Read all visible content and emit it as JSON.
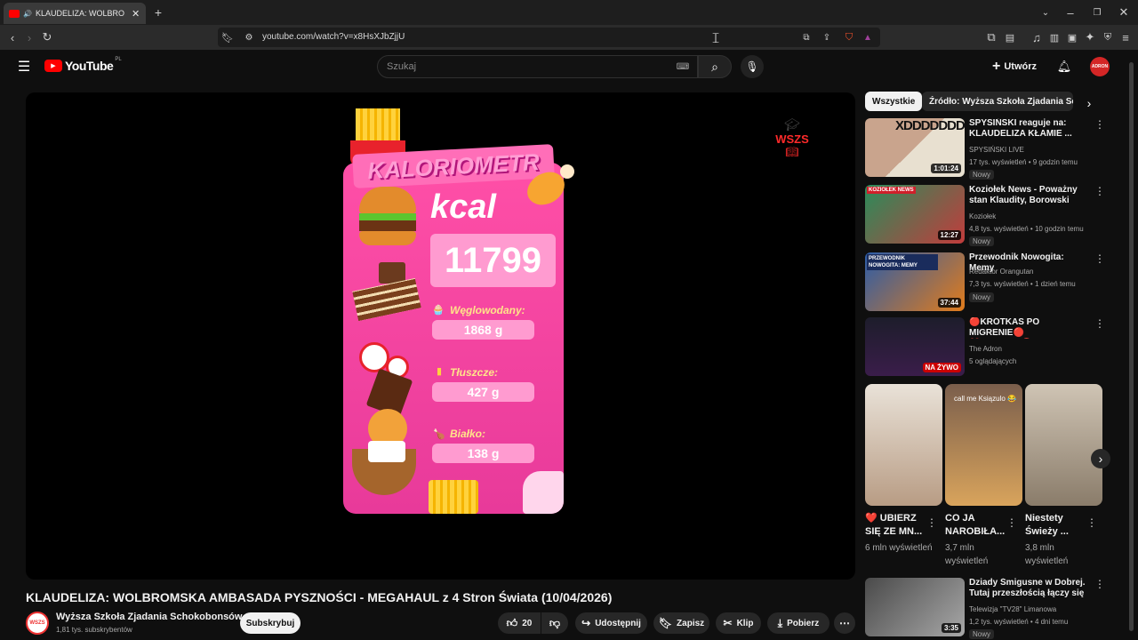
{
  "browser": {
    "tab_title": "KLAUDELIZA: WOLBROMSKA",
    "url": "youtube.com/watch?v=x8HsXJbZjjU"
  },
  "header": {
    "logo": "YouTube",
    "region": "PL",
    "search_placeholder": "Szukaj",
    "create_label": "Utwórz",
    "avatar_text": "ADRON"
  },
  "video": {
    "overlay": {
      "banner": "KALORIOMETR",
      "kcal_label": "kcal",
      "kcal_value": "11799",
      "carbs_label": "Węglowodany:",
      "carbs_value": "1868 g",
      "fat_label": "Tłuszcze:",
      "fat_value": "427 g",
      "protein_label": "Białko:",
      "protein_value": "138 g",
      "watermark": "WSZS"
    },
    "title": "KLAUDELIZA: WOLBROMSKA AMBASADA PYSZNOŚCI - MEGAHAUL z 4 Stron Świata (10/04/2026)",
    "channel": "Wyższa Szkoła Zjadania Schokobonsów",
    "subscribers": "1,81 tys. subskrybentów",
    "subscribe_label": "Subskrybuj",
    "likes": "20",
    "share_label": "Udostępnij",
    "save_label": "Zapisz",
    "clip_label": "Klip",
    "download_label": "Pobierz"
  },
  "sidebar": {
    "chips": [
      "Wszystkie",
      "Źródło: Wyższa Szkoła Zjadania Schokobonsów"
    ],
    "recommendations": [
      {
        "title": "SPYSIŃSKI reaguje na: KLAUDELIZA KŁAMIE ...",
        "channel": "SPYSIŃSKI LIVE",
        "meta": "17 tys. wyświetleń • 9 godzin temu",
        "badge": "Nowy",
        "duration": "1:01:24",
        "thumb_text": "XDDDDDDD"
      },
      {
        "title": "Koziołek News - Poważny stan Klaudity, Borowski okradziony,...",
        "channel": "Koziołek",
        "meta": "4,8 tys. wyświetleń • 10 godzin temu",
        "badge": "Nowy",
        "duration": "12:27",
        "thumb_text": "KOZIOŁEK NEWS"
      },
      {
        "title": "Przewodnik Nowogita: Memy",
        "channel": "Redaktor Orangutan",
        "meta": "7,3 tys. wyświetleń • 1 dzień temu",
        "badge": "Nowy",
        "duration": "37:44",
        "thumb_text": "PRZEWODNIK NOWOGITA: MEMY"
      },
      {
        "title": "🔴KRÓTKAS PO MIGRENIE🔴 ❤️!wsparcie🔴!donate",
        "channel": "The Adron",
        "meta": "5 oglądających",
        "badge": "",
        "duration": "NA ŻYWO",
        "thumb_text": ""
      },
      {
        "title": "Dziady Śmigusne w Dobrej. Tutaj przeszłością łączy się z ...",
        "channel": "Telewizja \"TV28\" Limanowa",
        "meta": "1,2 tys. wyświetleń • 4 dni temu",
        "badge": "Nowy",
        "duration": "3:35",
        "thumb_text": ""
      }
    ],
    "shorts": [
      {
        "title": "❤️ UBIERZ SIĘ ZE MN...",
        "views": "6 mln wyświetleń",
        "caption": ""
      },
      {
        "title": "CO JA NAROBIŁA...",
        "views": "3,7 mln wyświetleń",
        "caption": "call me Ksiązulo 😂"
      },
      {
        "title": "Niestety Świeży ...",
        "views": "3,8 mln wyświetleń",
        "caption": ""
      }
    ]
  }
}
